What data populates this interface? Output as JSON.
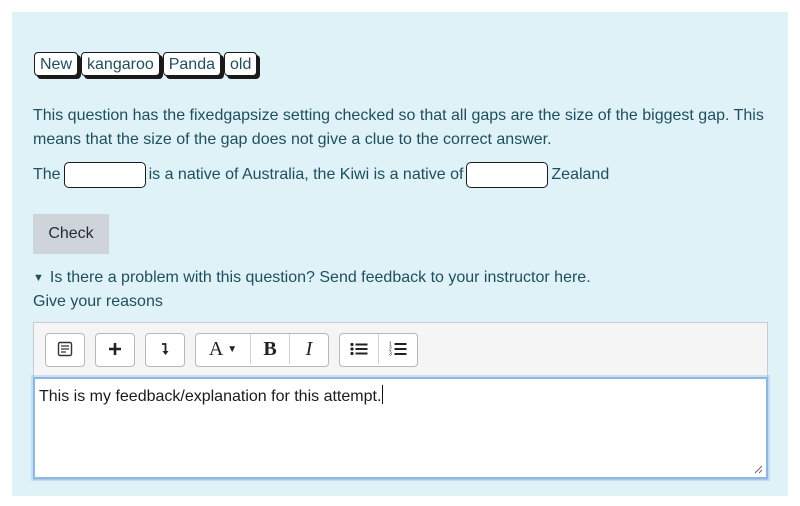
{
  "drag_items": [
    {
      "label": "New"
    },
    {
      "label": "kangaroo"
    },
    {
      "label": "Panda"
    },
    {
      "label": "old"
    }
  ],
  "question": {
    "description": "This question has the fixedgapsize setting checked so that all gaps are the size of the biggest gap. This means that the size of the gap does not give a clue to the correct answer.",
    "sentence_part1": "The",
    "sentence_part2": "is a native of Australia, the Kiwi is a native of",
    "sentence_part3": "Zealand"
  },
  "check_label": "Check",
  "feedback": {
    "summary": "Is there a problem with this question? Send feedback to your instructor here.",
    "reasons_label": "Give your reasons",
    "text": "This is my feedback/explanation for this attempt."
  },
  "toolbar": {
    "icons": [
      "show-more-icon",
      "plus-icon",
      "arrow-down-icon",
      "font-size-icon",
      "bold-icon",
      "italic-icon",
      "unordered-list-icon",
      "ordered-list-icon"
    ],
    "font_label": "A",
    "bold_label": "B",
    "italic_label": "I"
  }
}
